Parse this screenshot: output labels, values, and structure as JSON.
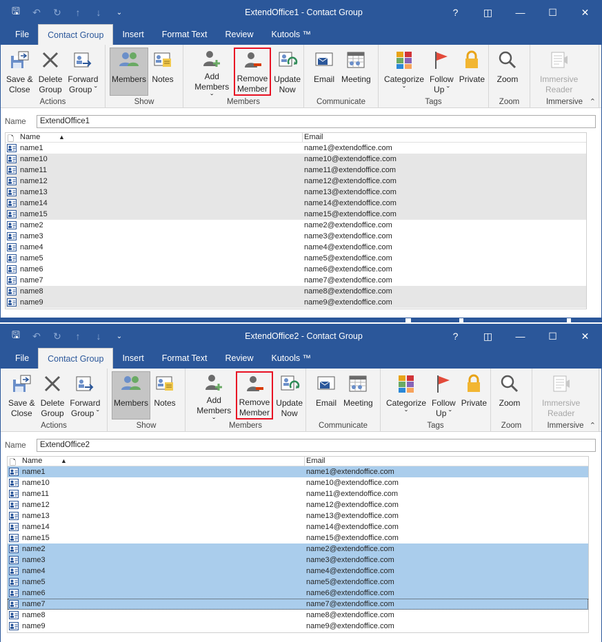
{
  "ribbon": {
    "tabs": [
      "File",
      "Contact Group",
      "Insert",
      "Format Text",
      "Review",
      "Kutools ™"
    ],
    "groups": {
      "actions": "Actions",
      "show": "Show",
      "members": "Members",
      "communicate": "Communicate",
      "tags": "Tags",
      "zoom": "Zoom",
      "immersive": "Immersive"
    },
    "buttons": {
      "save_close": [
        "Save &",
        "Close"
      ],
      "delete_group": [
        "Delete",
        "Group"
      ],
      "forward_group": [
        "Forward",
        "Group ˇ"
      ],
      "members": [
        "Members",
        ""
      ],
      "notes": [
        "Notes",
        ""
      ],
      "add_members": [
        "Add",
        "Members ˇ"
      ],
      "remove_member": [
        "Remove",
        "Member"
      ],
      "update_now": [
        "Update",
        "Now"
      ],
      "email": [
        "Email",
        ""
      ],
      "meeting": [
        "Meeting",
        ""
      ],
      "categorize": [
        "Categorize",
        "ˇ"
      ],
      "follow_up": [
        "Follow",
        "Up ˇ"
      ],
      "private": [
        "Private",
        ""
      ],
      "zoom": [
        "Zoom",
        ""
      ],
      "immersive_reader": [
        "Immersive",
        "Reader"
      ]
    },
    "colors": {
      "titlebar": "#2b579a",
      "highlight_box": "#e81123",
      "gray_row": "#e6e6e6",
      "selected_row": "#aacdec"
    }
  },
  "labels": {
    "name_label": "Name",
    "col_name": "Name",
    "col_email": "Email"
  },
  "windows": [
    {
      "title": "ExtendOffice1  -  Contact Group",
      "name_value": "ExtendOffice1",
      "rows": [
        {
          "name": "name1",
          "email": "name1@extendoffice.com",
          "state": "normal"
        },
        {
          "name": "name10",
          "email": "name10@extendoffice.com",
          "state": "gray"
        },
        {
          "name": "name11",
          "email": "name11@extendoffice.com",
          "state": "gray"
        },
        {
          "name": "name12",
          "email": "name12@extendoffice.com",
          "state": "gray"
        },
        {
          "name": "name13",
          "email": "name13@extendoffice.com",
          "state": "gray"
        },
        {
          "name": "name14",
          "email": "name14@extendoffice.com",
          "state": "gray"
        },
        {
          "name": "name15",
          "email": "name15@extendoffice.com",
          "state": "gray"
        },
        {
          "name": "name2",
          "email": "name2@extendoffice.com",
          "state": "normal"
        },
        {
          "name": "name3",
          "email": "name3@extendoffice.com",
          "state": "normal"
        },
        {
          "name": "name4",
          "email": "name4@extendoffice.com",
          "state": "normal"
        },
        {
          "name": "name5",
          "email": "name5@extendoffice.com",
          "state": "normal"
        },
        {
          "name": "name6",
          "email": "name6@extendoffice.com",
          "state": "normal"
        },
        {
          "name": "name7",
          "email": "name7@extendoffice.com",
          "state": "normal"
        },
        {
          "name": "name8",
          "email": "name8@extendoffice.com",
          "state": "gray"
        },
        {
          "name": "name9",
          "email": "name9@extendoffice.com",
          "state": "gray"
        }
      ]
    },
    {
      "title": "ExtendOffice2  -  Contact Group",
      "name_value": "ExtendOffice2",
      "rows": [
        {
          "name": "name1",
          "email": "name1@extendoffice.com",
          "state": "blue"
        },
        {
          "name": "name10",
          "email": "name10@extendoffice.com",
          "state": "normal"
        },
        {
          "name": "name11",
          "email": "name11@extendoffice.com",
          "state": "normal"
        },
        {
          "name": "name12",
          "email": "name12@extendoffice.com",
          "state": "normal"
        },
        {
          "name": "name13",
          "email": "name13@extendoffice.com",
          "state": "normal"
        },
        {
          "name": "name14",
          "email": "name14@extendoffice.com",
          "state": "normal"
        },
        {
          "name": "name15",
          "email": "name15@extendoffice.com",
          "state": "normal"
        },
        {
          "name": "name2",
          "email": "name2@extendoffice.com",
          "state": "blue"
        },
        {
          "name": "name3",
          "email": "name3@extendoffice.com",
          "state": "blue"
        },
        {
          "name": "name4",
          "email": "name4@extendoffice.com",
          "state": "blue"
        },
        {
          "name": "name5",
          "email": "name5@extendoffice.com",
          "state": "blue"
        },
        {
          "name": "name6",
          "email": "name6@extendoffice.com",
          "state": "blue"
        },
        {
          "name": "name7",
          "email": "name7@extendoffice.com",
          "state": "focus"
        },
        {
          "name": "name8",
          "email": "name8@extendoffice.com",
          "state": "normal"
        },
        {
          "name": "name9",
          "email": "name9@extendoffice.com",
          "state": "normal"
        }
      ]
    }
  ]
}
